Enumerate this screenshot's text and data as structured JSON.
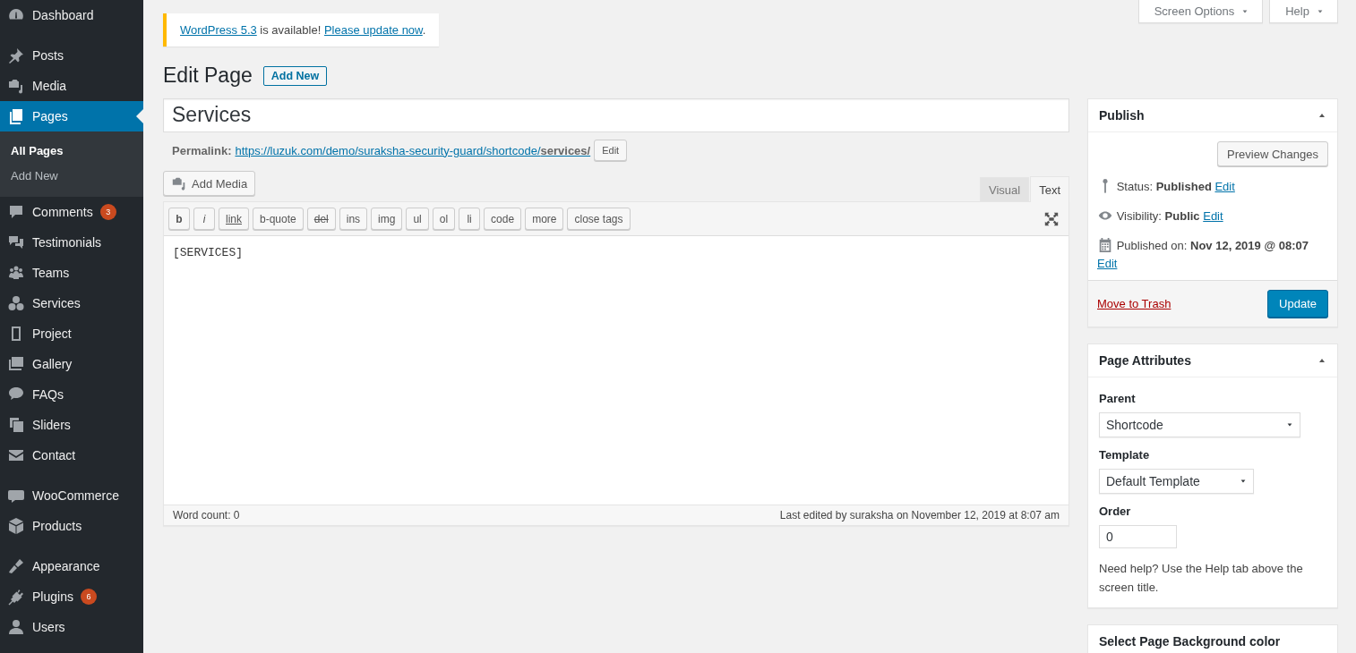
{
  "top_buttons": [
    {
      "label": "Screen Options"
    },
    {
      "label": "Help"
    }
  ],
  "sidebar": {
    "groups": [
      {
        "items": [
          {
            "label": "Dashboard",
            "selected": false
          }
        ]
      },
      {
        "items": [
          {
            "label": "Posts",
            "selected": false
          },
          {
            "label": "Media",
            "selected": false
          },
          {
            "label": "Pages",
            "selected": true,
            "children": [
              {
                "label": "All Pages",
                "selected": true
              },
              {
                "label": "Add New",
                "selected": false
              }
            ]
          },
          {
            "label": "Comments",
            "selected": false,
            "badge": "3"
          },
          {
            "label": "Testimonials",
            "selected": false
          },
          {
            "label": "Teams",
            "selected": false
          },
          {
            "label": "Services",
            "selected": false
          },
          {
            "label": "Project",
            "selected": false
          },
          {
            "label": "Gallery",
            "selected": false
          },
          {
            "label": "FAQs",
            "selected": false
          },
          {
            "label": "Sliders",
            "selected": false
          },
          {
            "label": "Contact",
            "selected": false
          }
        ]
      },
      {
        "items": [
          {
            "label": "WooCommerce",
            "selected": false
          },
          {
            "label": "Products",
            "selected": false
          }
        ]
      },
      {
        "items": [
          {
            "label": "Appearance",
            "selected": false
          },
          {
            "label": "Plugins",
            "selected": false,
            "badge": "6"
          },
          {
            "label": "Users",
            "selected": false
          }
        ]
      }
    ]
  },
  "notice": {
    "parts": [
      {
        "text": "WordPress 5.3",
        "kind": "link"
      },
      {
        "text": " is available! ",
        "kind": "text"
      },
      {
        "text": "Please update now",
        "kind": "link"
      },
      {
        "text": ".",
        "kind": "text"
      }
    ]
  },
  "heading": {
    "title": "Edit Page",
    "add_new": "Add New"
  },
  "editor": {
    "title_value": "Services",
    "permalink_label": "Permalink:",
    "permalink": "https://luzuk.com/demo/suraksha-security-guard/shortcode/**services/**",
    "permalink_edit": "Edit",
    "add_media": "Add Media",
    "tabs": [
      {
        "label": "Visual",
        "selected": false
      },
      {
        "label": "Text",
        "selected": true
      }
    ],
    "toolbar": [
      {
        "label": "b",
        "kind": "bold"
      },
      {
        "label": "i",
        "kind": "italic"
      },
      {
        "label": "link",
        "kind": "underline"
      },
      {
        "label": "b-quote",
        "kind": "plain"
      },
      {
        "label": "del",
        "kind": "strike"
      },
      {
        "label": "ins",
        "kind": "plain"
      },
      {
        "label": "img",
        "kind": "plain"
      },
      {
        "label": "ul",
        "kind": "plain"
      },
      {
        "label": "ol",
        "kind": "plain"
      },
      {
        "label": "li",
        "kind": "plain"
      },
      {
        "label": "code",
        "kind": "plain"
      },
      {
        "label": "more",
        "kind": "plain"
      },
      {
        "label": "close tags",
        "kind": "plain"
      }
    ],
    "content": "[SERVICES]",
    "word_count": "Word count: 0",
    "last_edited": "Last edited by suraksha on November 12, 2019 at 8:07 am"
  },
  "publish": {
    "title": "Publish",
    "preview_button": "Preview Changes",
    "rows": [
      {
        "text": "Status: **Published**",
        "link": "Edit"
      },
      {
        "text": "Visibility: **Public**",
        "link": "Edit"
      },
      {
        "text": "Published on: **Nov 12, 2019 @ 08:07**",
        "link": "Edit"
      }
    ],
    "trash_link": "Move to Trash",
    "update_button": "Update"
  },
  "page_attributes": {
    "title": "Page Attributes",
    "parent_label": "Parent",
    "parent_value": "Shortcode",
    "template_label": "Template",
    "template_value": "Default Template",
    "order_label": "Order",
    "order_value": "0",
    "help": "Need help? Use the Help tab above the screen title."
  },
  "background_box": {
    "title": "Select Page Background color"
  }
}
